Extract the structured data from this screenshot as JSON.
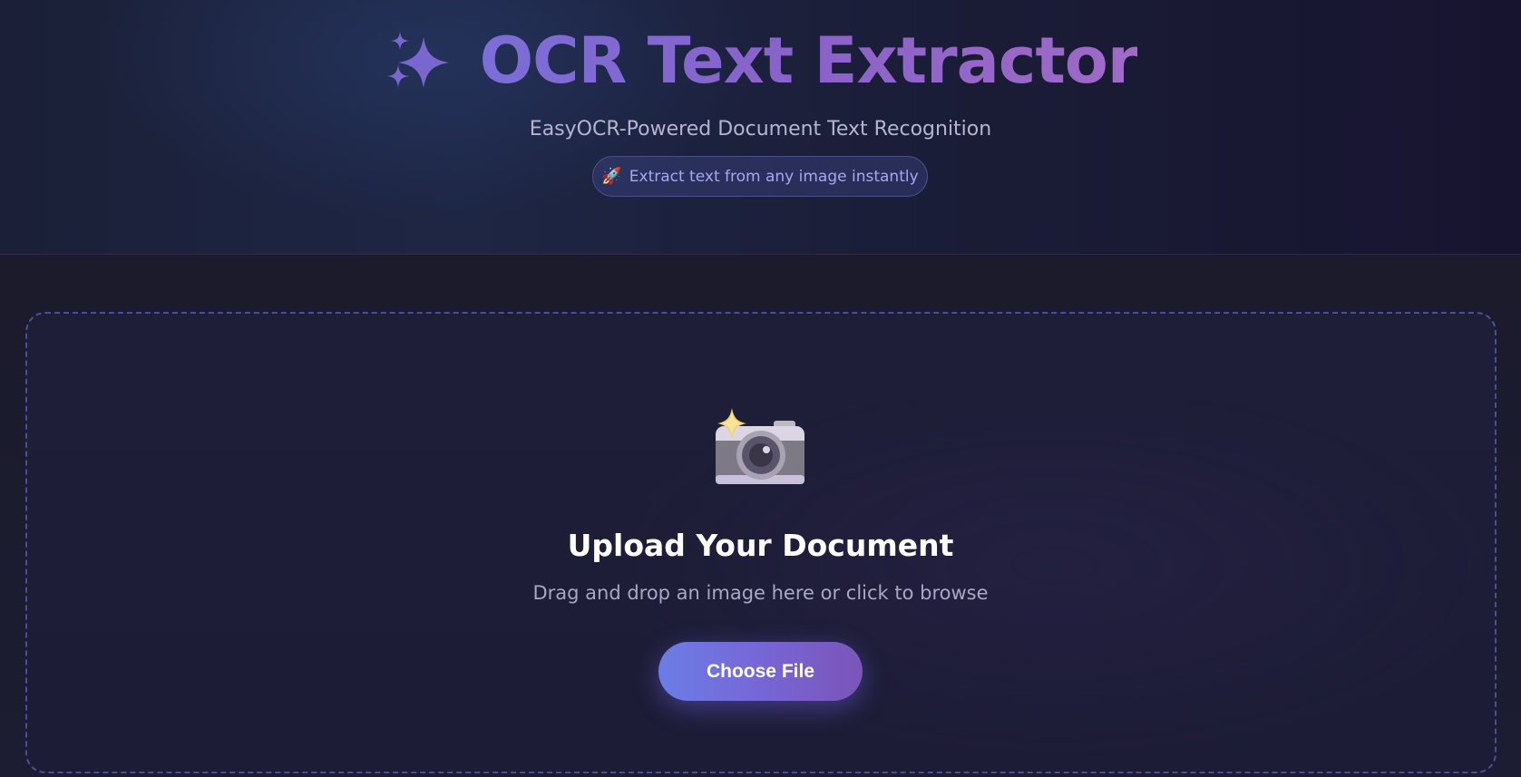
{
  "header": {
    "title": "OCR Text Extractor",
    "title_icon": "sparkles-icon",
    "subtitle": "EasyOCR-Powered Document Text Recognition",
    "badge": {
      "icon": "🚀",
      "icon_name": "rocket-icon",
      "text": "Extract text from any image instantly"
    }
  },
  "upload": {
    "icon": "camera-with-flash-icon",
    "title": "Upload Your Document",
    "hint": "Drag and drop an image here or click to browse",
    "button_label": "Choose File"
  },
  "colors": {
    "background": "#1b1b2e",
    "accent_start": "#6c7de6",
    "accent_end": "#7b55b9",
    "title_gradient_start": "#7b6ed6",
    "title_gradient_end": "#a06ac8",
    "dropzone_border": "#4b4f92"
  }
}
